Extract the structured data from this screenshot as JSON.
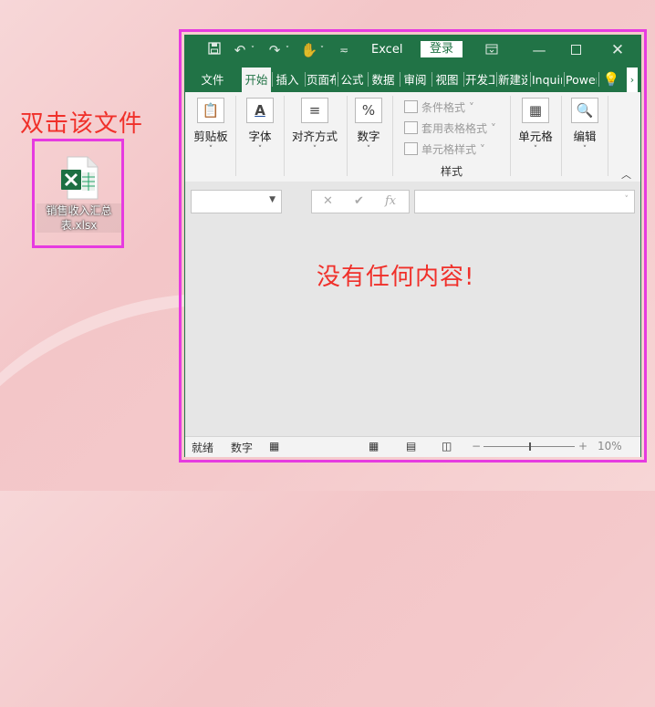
{
  "annotation": {
    "desktop_hint": "双击该文件",
    "empty_hint": "没有任何内容!"
  },
  "desktop": {
    "file_name": "销售收入汇总表.xlsx",
    "file_icon": "excel-file-icon"
  },
  "window": {
    "app_name": "Excel",
    "login_label": "登录",
    "controls": [
      "save-icon",
      "undo-icon",
      "redo-icon",
      "touch-mode-icon",
      "customize-icon",
      "ribbon-display-icon",
      "minimize-icon",
      "maximize-icon",
      "close-icon"
    ]
  },
  "tabs": [
    {
      "label": "文件"
    },
    {
      "label": "开始"
    },
    {
      "label": "插入"
    },
    {
      "label": "页面布局"
    },
    {
      "label": "公式"
    },
    {
      "label": "数据"
    },
    {
      "label": "审阅"
    },
    {
      "label": "视图"
    },
    {
      "label": "开发工具"
    },
    {
      "label": "新建选项卡"
    },
    {
      "label": "Inquire"
    },
    {
      "label": "Power Pivot"
    }
  ],
  "ribbon": {
    "clipboard": "剪贴板",
    "font": "字体",
    "alignment": "对齐方式",
    "number": "数字",
    "conditional_format": "条件格式",
    "table_format": "套用表格格式",
    "cell_style": "单元格样式",
    "styles_group": "样式",
    "cells": "单元格",
    "editing": "编辑"
  },
  "formula_bar": {
    "fx_label": "fx",
    "name_value": "",
    "formula_value": ""
  },
  "status_bar": {
    "ready": "就绪",
    "num": "数字",
    "zoom_minus": "−",
    "zoom_plus": "+",
    "zoom_level": "10%"
  }
}
